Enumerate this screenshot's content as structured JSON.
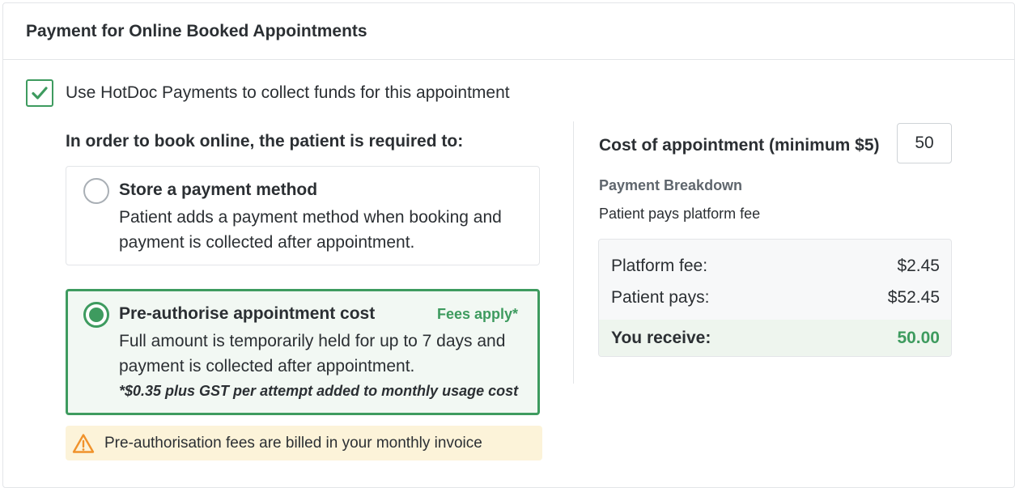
{
  "card": {
    "title": "Payment for Online Booked Appointments"
  },
  "use_payments": {
    "checked": true,
    "label": "Use HotDoc Payments to collect funds for this appointment"
  },
  "requirement_heading": "In order to book online, the patient is required to:",
  "options": [
    {
      "title": "Store a payment method",
      "description": "Patient adds a payment method when booking and payment is collected after appointment.",
      "selected": false
    },
    {
      "title": "Pre-authorise appointment cost",
      "badge": "Fees apply*",
      "description": "Full amount is temporarily held for up to 7 days and payment is collected after appointment.",
      "footnote": "*$0.35 plus GST per attempt added to monthly usage cost",
      "selected": true
    }
  ],
  "warning": {
    "icon": "warning-triangle-icon",
    "text": "Pre-authorisation fees are billed in your monthly invoice"
  },
  "cost": {
    "label": "Cost of appointment (minimum $5)",
    "value": "50"
  },
  "breakdown": {
    "title": "Payment Breakdown",
    "subtitle": "Patient pays platform fee",
    "rows": [
      {
        "label": "Platform fee:",
        "value": "$2.45"
      },
      {
        "label": "Patient pays:",
        "value": "$52.45"
      },
      {
        "label": "You receive:",
        "value": "50.00"
      }
    ]
  },
  "colors": {
    "accent_green": "#3e9b5f",
    "warning_bg": "#fcf3d9",
    "warning_icon": "#f0922b",
    "border": "#e3e5e8"
  }
}
